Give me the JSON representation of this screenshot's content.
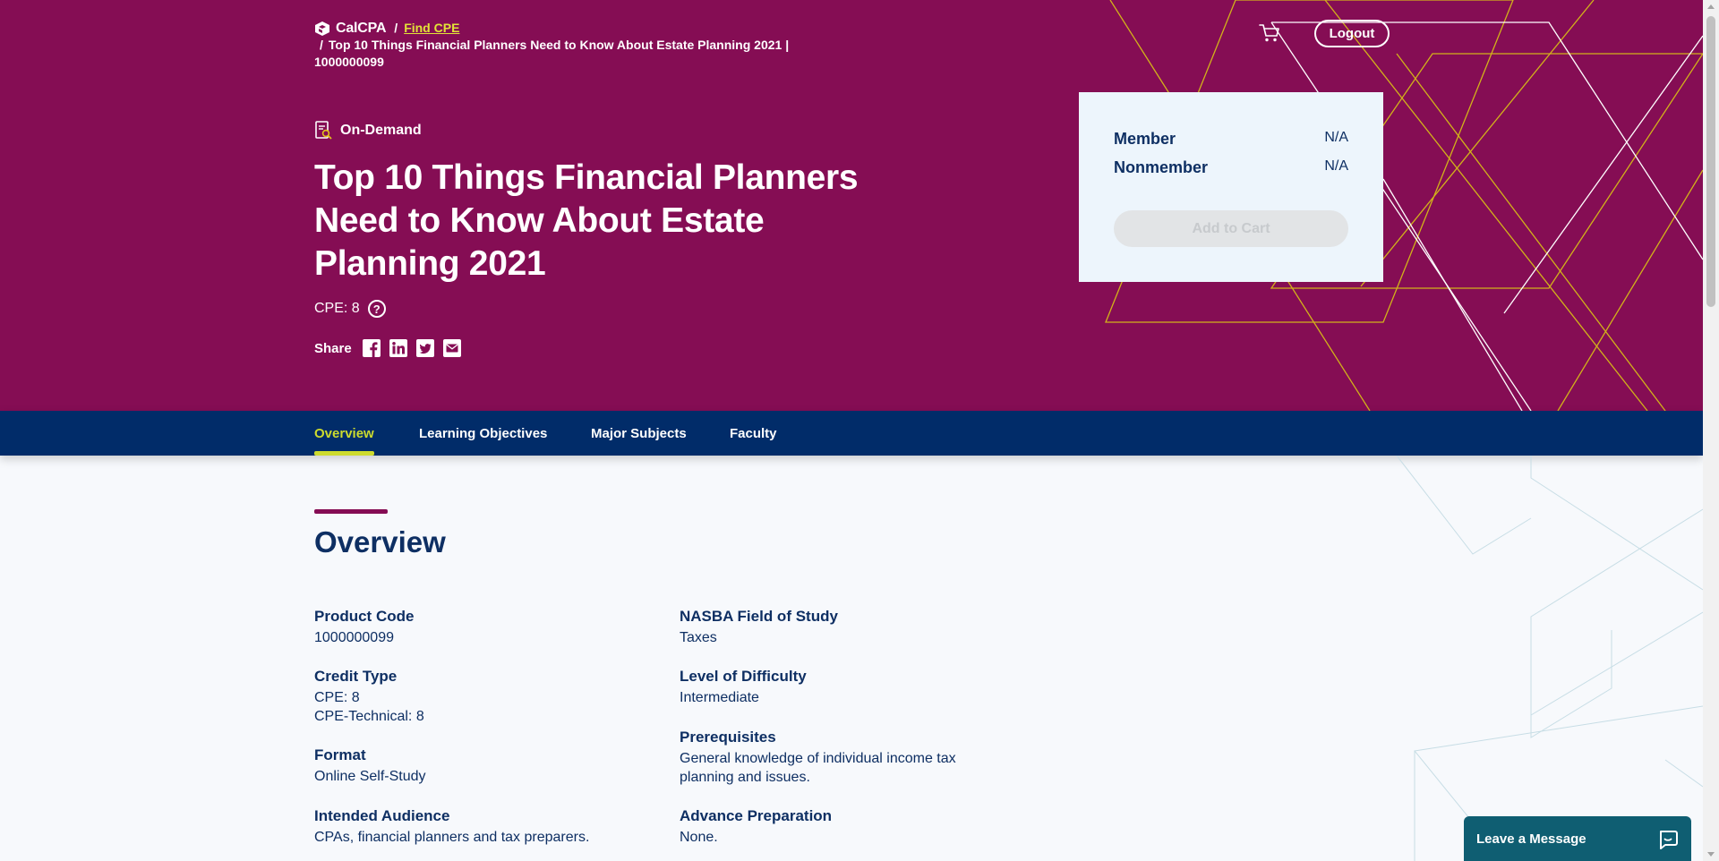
{
  "header": {
    "brand": "CalCPA",
    "breadcrumb_separator": "/",
    "breadcrumb_link": "Find CPE",
    "breadcrumb_current": "Top 10 Things Financial Planners Need to Know About Estate Planning 2021 | 1000000099",
    "cart_icon": "cart-icon",
    "logout_label": "Logout"
  },
  "hero": {
    "format_icon": "on-demand-icon",
    "format_label": "On-Demand",
    "title": "Top 10 Things Financial Planners Need to Know About Estate Planning 2021",
    "cpe_label": "CPE: 8",
    "help_icon_glyph": "?",
    "share_label": "Share",
    "share_icons": [
      "facebook-icon",
      "linkedin-icon",
      "twitter-icon",
      "email-icon"
    ]
  },
  "pricing": {
    "member_label": "Member",
    "member_value": "N/A",
    "nonmember_label": "Nonmember",
    "nonmember_value": "N/A",
    "add_to_cart_label": "Add to Cart"
  },
  "tabs": [
    {
      "label": "Overview",
      "active": true
    },
    {
      "label": "Learning Objectives",
      "active": false
    },
    {
      "label": "Major Subjects",
      "active": false
    },
    {
      "label": "Faculty",
      "active": false
    }
  ],
  "overview": {
    "section_title": "Overview",
    "fields": {
      "product_code": {
        "label": "Product Code",
        "value": "1000000099"
      },
      "credit_type": {
        "label": "Credit Type",
        "value_1": "CPE: 8",
        "value_2": "CPE-Technical: 8"
      },
      "format": {
        "label": "Format",
        "value": "Online Self-Study"
      },
      "intended_audience": {
        "label": "Intended Audience",
        "value": "CPAs, financial planners and tax preparers."
      },
      "nasba_field": {
        "label": "NASBA Field of Study",
        "value": "Taxes"
      },
      "level_of_difficulty": {
        "label": "Level of Difficulty",
        "value": "Intermediate"
      },
      "prerequisites": {
        "label": "Prerequisites",
        "value": "General knowledge of individual income tax planning and issues."
      },
      "advance_preparation": {
        "label": "Advance Preparation",
        "value": "None."
      }
    }
  },
  "chat": {
    "label": "Leave a Message",
    "icon": "chat-bubble-icon"
  },
  "colors": {
    "hero_bg": "#850d54",
    "nav_bg": "#012c69",
    "accent_yellow": "#cddb2e",
    "heading_navy": "#0e2f63",
    "card_bg": "#edf5fc",
    "chat_bg": "#0f5e72"
  }
}
